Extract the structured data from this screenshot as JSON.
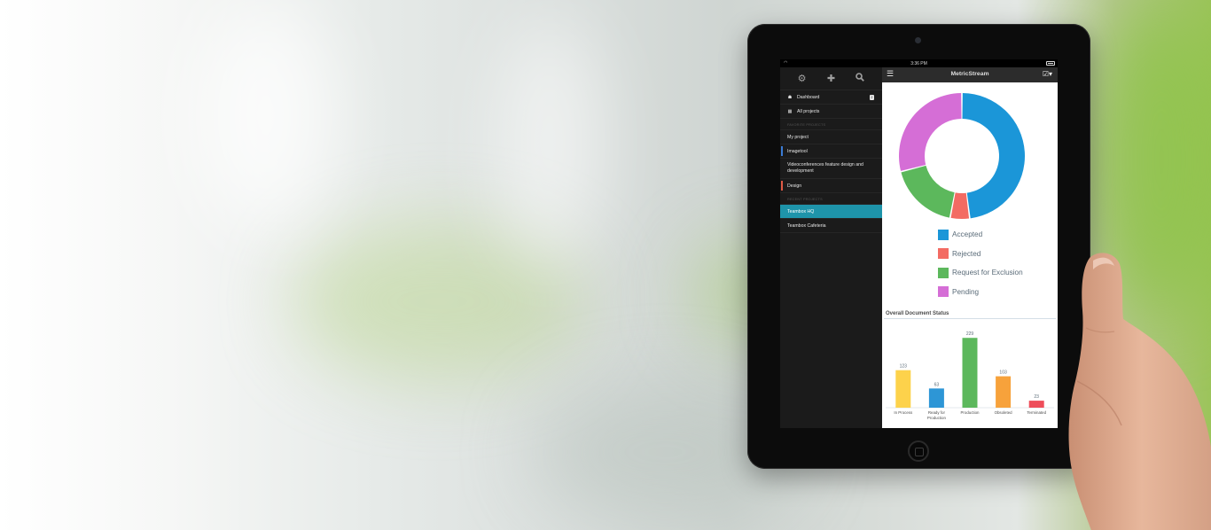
{
  "device": {
    "status_time": "3:36 PM"
  },
  "sidebar": {
    "toolbar": [
      {
        "icon": "gear-icon",
        "glyph": "⚙"
      },
      {
        "icon": "plus-icon",
        "glyph": "✚"
      },
      {
        "icon": "search-icon",
        "glyph": "🔍"
      }
    ],
    "nav": [
      {
        "label": "Dashboard",
        "icon": "home-icon",
        "badge": "2"
      },
      {
        "label": "All projects",
        "icon": "grid-icon"
      }
    ],
    "favorite_header": "FAVORITE PROJECTS",
    "favorites": [
      {
        "label": "My project"
      },
      {
        "label": "Imagetool",
        "marker_color": "#3a7bd5"
      },
      {
        "label": "Videoconferences feature design and development"
      },
      {
        "label": "Design",
        "marker_color": "#e05a45"
      }
    ],
    "recent_header": "RECENT PROJECTS",
    "recent": [
      {
        "label": "Teambox HQ",
        "active": true
      },
      {
        "label": "Teambox Cafeteria"
      }
    ]
  },
  "header": {
    "title": "MetricStream"
  },
  "colors": {
    "accent": "#1e94aa",
    "accepted": "#1b96d8",
    "rejected": "#f36b63",
    "request_for_exclusion": "#5cb85c",
    "pending": "#d56ed6"
  },
  "chart_data": [
    {
      "type": "pie",
      "donut": true,
      "series": [
        {
          "name": "Accepted",
          "value": 48,
          "color": "#1b96d8"
        },
        {
          "name": "Rejected",
          "value": 5,
          "color": "#f36b63"
        },
        {
          "name": "Request for Exclusion",
          "value": 18,
          "color": "#5cb85c"
        },
        {
          "name": "Pending",
          "value": 29,
          "color": "#d56ed6"
        }
      ],
      "legend": "bottom"
    },
    {
      "type": "bar",
      "title": "Overall Document Status",
      "categories": [
        "In Process",
        "Ready for Production",
        "Production",
        "Obsoleted",
        "Terminated"
      ],
      "values": [
        123,
        63,
        229,
        103,
        23
      ],
      "colors": [
        "#fdd24b",
        "#2d96d6",
        "#5cb85c",
        "#f7a23b",
        "#ee4d5a"
      ],
      "ylim": [
        0,
        250
      ],
      "grid": false
    }
  ]
}
